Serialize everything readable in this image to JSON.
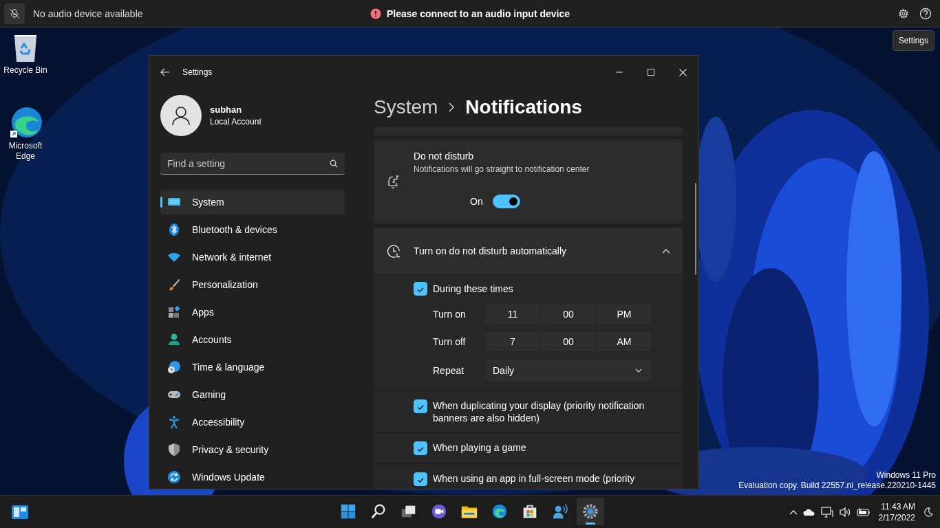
{
  "top_bar": {
    "mic_status": "No audio device available",
    "alert": "Please connect to an audio input device",
    "tooltip": "Settings"
  },
  "desktop_icons": [
    {
      "label": "Recycle Bin"
    },
    {
      "label": "Microsoft Edge"
    }
  ],
  "window": {
    "title": "Settings",
    "user": {
      "name": "subhan",
      "account_type": "Local Account"
    },
    "search": {
      "placeholder": "Find a setting"
    },
    "nav": [
      {
        "label": "System",
        "selected": true
      },
      {
        "label": "Bluetooth & devices",
        "selected": false
      },
      {
        "label": "Network & internet",
        "selected": false
      },
      {
        "label": "Personalization",
        "selected": false
      },
      {
        "label": "Apps",
        "selected": false
      },
      {
        "label": "Accounts",
        "selected": false
      },
      {
        "label": "Time & language",
        "selected": false
      },
      {
        "label": "Gaming",
        "selected": false
      },
      {
        "label": "Accessibility",
        "selected": false
      },
      {
        "label": "Privacy & security",
        "selected": false
      },
      {
        "label": "Windows Update",
        "selected": false
      }
    ],
    "breadcrumb": [
      "System",
      "Notifications"
    ],
    "dnd": {
      "title": "Do not disturb",
      "description": "Notifications will go straight to notification center",
      "toggle_label": "On",
      "on": true
    },
    "auto": {
      "title": "Turn on do not disturb automatically",
      "expanded": true,
      "during_times": {
        "label": "During these times",
        "checked": true
      },
      "schedule": [
        {
          "label": "Turn on",
          "hour": "11",
          "minute": "00",
          "period": "PM"
        },
        {
          "label": "Turn off",
          "hour": "7",
          "minute": "00",
          "period": "AM"
        }
      ],
      "repeat": {
        "label": "Repeat",
        "value": "Daily"
      },
      "options": [
        {
          "label": "When duplicating your display (priority notification banners are also hidden)",
          "checked": true
        },
        {
          "label": "When playing a game",
          "checked": true
        },
        {
          "label": "When using an app in full-screen mode (priority",
          "checked": true
        }
      ]
    }
  },
  "edition_notice": [
    "Windows 11 Pro",
    "Evaluation copy. Build 22557.ni_release.220210-1445"
  ],
  "taskbar": {
    "apps": [
      {
        "selected": false
      },
      {
        "selected": false
      },
      {
        "selected": false
      },
      {
        "selected": false
      },
      {
        "selected": false
      },
      {
        "selected": false
      },
      {
        "selected": false
      },
      {
        "selected": false
      },
      {
        "selected": true
      }
    ],
    "time": "11:43 AM",
    "date": "2/17/2022"
  }
}
